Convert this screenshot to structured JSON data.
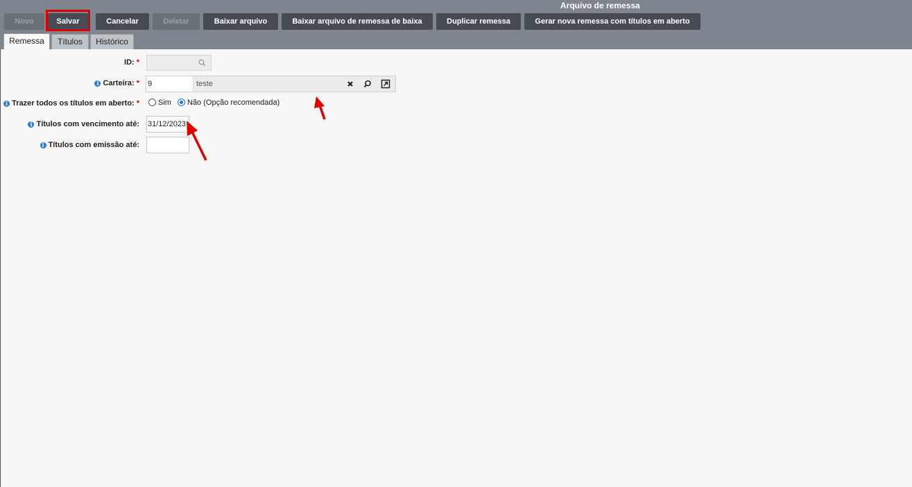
{
  "window": {
    "title": "Arquivo de remessa"
  },
  "toolbar": {
    "novo": "Novo",
    "salvar": "Salvar",
    "cancelar": "Cancelar",
    "deletar": "Deletar",
    "baixar_arquivo": "Baixar arquivo",
    "baixar_remessa_baixa": "Baixar arquivo de remessa de baixa",
    "duplicar": "Duplicar remessa",
    "gerar_nova": "Gerar nova remessa com títulos em aberto"
  },
  "tabs": [
    {
      "label": "Remessa",
      "active": true
    },
    {
      "label": "Títulos",
      "active": false
    },
    {
      "label": "Histórico",
      "active": false
    }
  ],
  "form": {
    "required_mark": "*",
    "id": {
      "label": "ID:",
      "value": ""
    },
    "carteira": {
      "label": "Carteira:",
      "code": "9",
      "description": "teste"
    },
    "trazer_todos": {
      "label": "Trazer todos os títulos em aberto:",
      "options": [
        "Sim",
        "Não (Opção recomendada)"
      ],
      "selected": "Não (Opção recomendada)"
    },
    "vencimento": {
      "label": "Títulos com vencimento até:",
      "value": "31/12/2023"
    },
    "emissao": {
      "label": "Títulos com emissão até:",
      "value": ""
    }
  },
  "colors": {
    "header": "#7e858f",
    "button": "#474c54",
    "highlight": "#e00000",
    "info": "#2a7bd4"
  },
  "icons": [
    "search-icon",
    "clear-icon",
    "lookup-icon",
    "open-link-icon",
    "info-icon",
    "red-arrow"
  ]
}
